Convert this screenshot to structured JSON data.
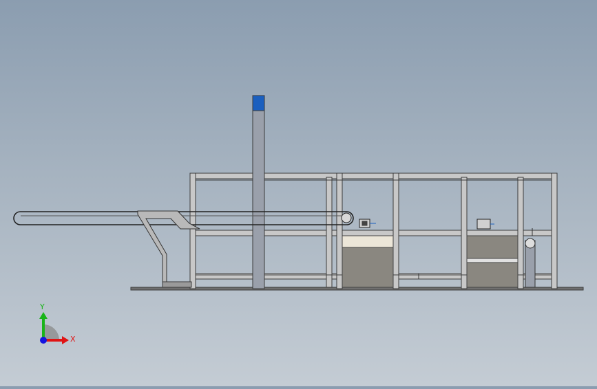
{
  "triad": {
    "x_label": "X",
    "y_label": "Y",
    "x_color": "#e01414",
    "y_color": "#19b419",
    "z_color": "#1414e0"
  },
  "model": {
    "frame_color": "#3b3b3b",
    "frame_fill": "#c8c8c8",
    "accent_color": "#1a5fbf",
    "panel_color": "#8a8780"
  }
}
